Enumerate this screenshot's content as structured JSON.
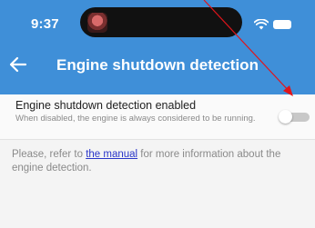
{
  "status_bar": {
    "time": "9:37",
    "icons": [
      "avatar-icon",
      "wifi-icon",
      "battery-icon"
    ]
  },
  "header": {
    "back_icon": "back-arrow-icon",
    "title": "Engine shutdown detection"
  },
  "setting": {
    "title": "Engine shutdown detection enabled",
    "description": "When disabled, the engine is always considered to be running.",
    "enabled": false
  },
  "info": {
    "prefix": "Please, refer to ",
    "link_text": "the manual",
    "suffix": " for more information about the engine detection."
  },
  "colors": {
    "header_bg": "#3f8fd8",
    "link": "#2a35c9",
    "annotation_arrow": "#e0151b"
  }
}
